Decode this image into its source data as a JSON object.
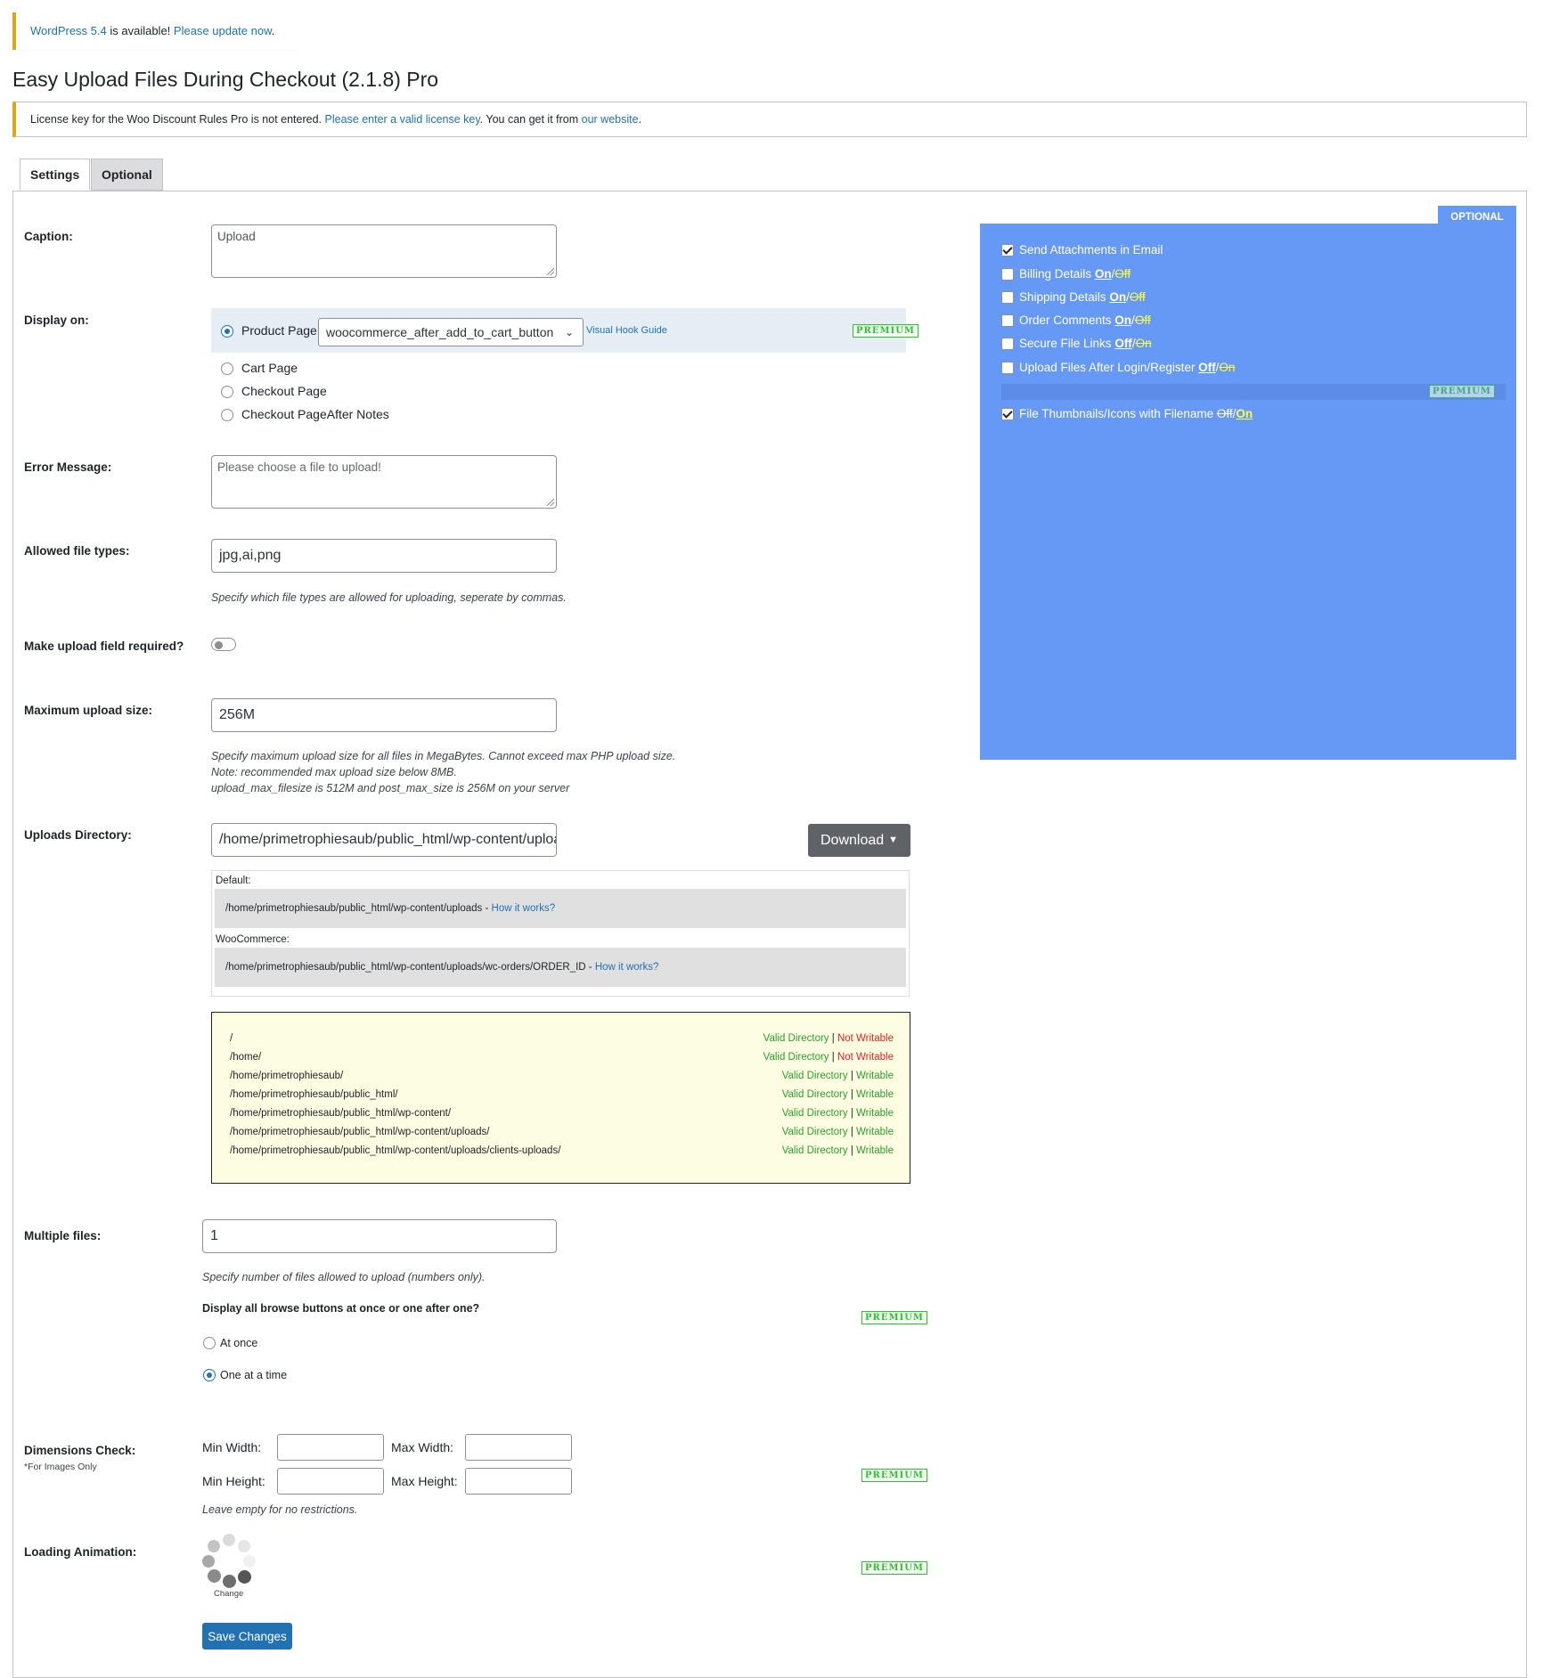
{
  "update_notice": {
    "version_link": "WordPress 5.4",
    "middle": " is available! ",
    "update_link": "Please update now",
    "end": "."
  },
  "page_title": "Easy Upload Files During Checkout (2.1.8) Pro",
  "license_notice": {
    "text1": "License key for the Woo Discount Rules Pro is not entered. ",
    "link1": "Please enter a valid license key",
    "text2": ". You can get it from ",
    "link2": "our website",
    "text3": "."
  },
  "tabs": [
    {
      "label": "Settings",
      "active": true
    },
    {
      "label": "Optional",
      "active": false
    }
  ],
  "premium_label": "PREMIUM",
  "caption": {
    "label": "Caption:",
    "value": "Upload"
  },
  "display_on": {
    "label": "Display on:",
    "options": [
      {
        "label": "Product Page",
        "checked": true
      },
      {
        "label": "Cart Page",
        "checked": false
      },
      {
        "label": "Checkout Page",
        "checked": false
      },
      {
        "label": "Checkout PageAfter Notes",
        "checked": false
      }
    ],
    "hook_value": "woocommerce_after_add_to_cart_button",
    "hook_guide": "Visual Hook Guide"
  },
  "error_message": {
    "label": "Error Message:",
    "placeholder": "Please choose a file to upload!"
  },
  "file_types": {
    "label": "Allowed file types:",
    "value": "jpg,ai,png",
    "hint": "Specify which file types are allowed for uploading, seperate by commas."
  },
  "required": {
    "label": "Make upload field required?",
    "on": false
  },
  "max_size": {
    "label": "Maximum upload size:",
    "value": "256M",
    "hint1": "Specify maximum upload size for all files in MegaBytes. Cannot exceed max PHP upload size.",
    "hint2": "Note: recommended max upload size below 8MB.",
    "hint3": "upload_max_filesize is 512M and post_max_size is 256M on your server"
  },
  "uploads_dir": {
    "label": "Uploads Directory:",
    "value": "/home/primetrophiesaub/public_html/wp-content/uploads/clients-uploads/",
    "download_label": "Download",
    "default_label": "Default:",
    "default_path": "/home/primetrophiesaub/public_html/wp-content/uploads - ",
    "woo_label": "WooCommerce:",
    "woo_path": "/home/primetrophiesaub/public_html/wp-content/uploads/wc-orders/ORDER_ID - ",
    "how_link": "How it works?",
    "valid_text": "Valid Directory",
    "not_writable_text": "Not Writable",
    "writable_text": "Writable",
    "separator": " | ",
    "dirs": [
      {
        "path": "/",
        "writable": false
      },
      {
        "path": "/home/",
        "writable": false
      },
      {
        "path": "/home/primetrophiesaub/",
        "writable": true
      },
      {
        "path": "/home/primetrophiesaub/public_html/",
        "writable": true
      },
      {
        "path": "/home/primetrophiesaub/public_html/wp-content/",
        "writable": true
      },
      {
        "path": "/home/primetrophiesaub/public_html/wp-content/uploads/",
        "writable": true
      },
      {
        "path": "/home/primetrophiesaub/public_html/wp-content/uploads/clients-uploads/",
        "writable": true
      }
    ]
  },
  "multiple": {
    "label": "Multiple files:",
    "value": "1",
    "hint": "Specify number of files allowed to upload (numbers only).",
    "question": "Display all browse buttons at once or one after one?",
    "opt_at_once": "At once",
    "opt_one_time": "One at a time",
    "selected": "one_at_a_time"
  },
  "dimensions": {
    "label": "Dimensions Check:",
    "sublabel": "*For Images Only",
    "min_width": "Min Width:",
    "max_width": "Max Width:",
    "min_height": "Min Height:",
    "max_height": "Max Height:",
    "hint": "Leave empty for no restrictions."
  },
  "loading": {
    "label": "Loading Animation:",
    "change": "Change"
  },
  "save_label": "Save Changes",
  "optional_panel": {
    "tab_label": "OPTIONAL",
    "on": "On",
    "off": "Off",
    "slash": "/",
    "items": [
      {
        "label": "Send Attachments in Email",
        "checked": true
      },
      {
        "label": "Billing Details ",
        "checked": false
      },
      {
        "label": "Shipping Details ",
        "checked": false
      },
      {
        "label": "Order Comments ",
        "checked": false
      },
      {
        "label": "Secure File Links ",
        "checked": false
      },
      {
        "label": "Upload Files After Login/Register ",
        "checked": false
      },
      {
        "label": "File Thumbnails/Icons with Filename ",
        "checked": true
      }
    ]
  },
  "colors": {
    "wp_blue": "#2271b1",
    "optional_bg": "#6699f5",
    "premium_green": "#2ec02e",
    "notice_yellow": "#dba617",
    "dir_box_bg": "#fdfde1"
  }
}
